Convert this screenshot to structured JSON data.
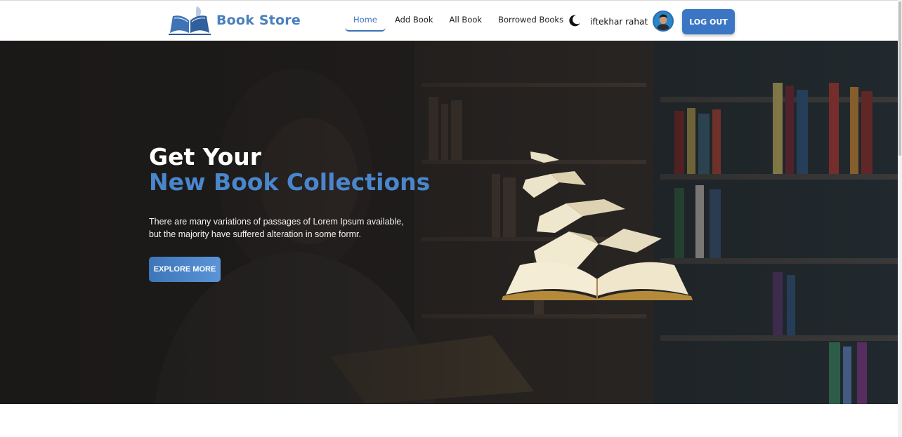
{
  "brand": {
    "name": "Book Store",
    "logo_icon": "open-book-quill-icon"
  },
  "nav": {
    "items": [
      {
        "label": "Home",
        "active": true
      },
      {
        "label": "Add Book",
        "active": false
      },
      {
        "label": "All Book",
        "active": false
      },
      {
        "label": "Borrowed Books",
        "active": false
      }
    ]
  },
  "user": {
    "name": "iftekhar rahat",
    "theme_icon": "moon-icon",
    "logout_label": "LOG OUT"
  },
  "hero": {
    "title_line1": "Get Your",
    "title_line2": "New Book Collections",
    "description": "There are many variations of passages of Lorem Ipsum available, but the majority have suffered alteration in some formr.",
    "button_label": "EXPLORE MORE"
  },
  "colors": {
    "accent": "#3b76c4",
    "heading_blue": "#4a86cc",
    "hero_overlay": "#1c1a19"
  }
}
